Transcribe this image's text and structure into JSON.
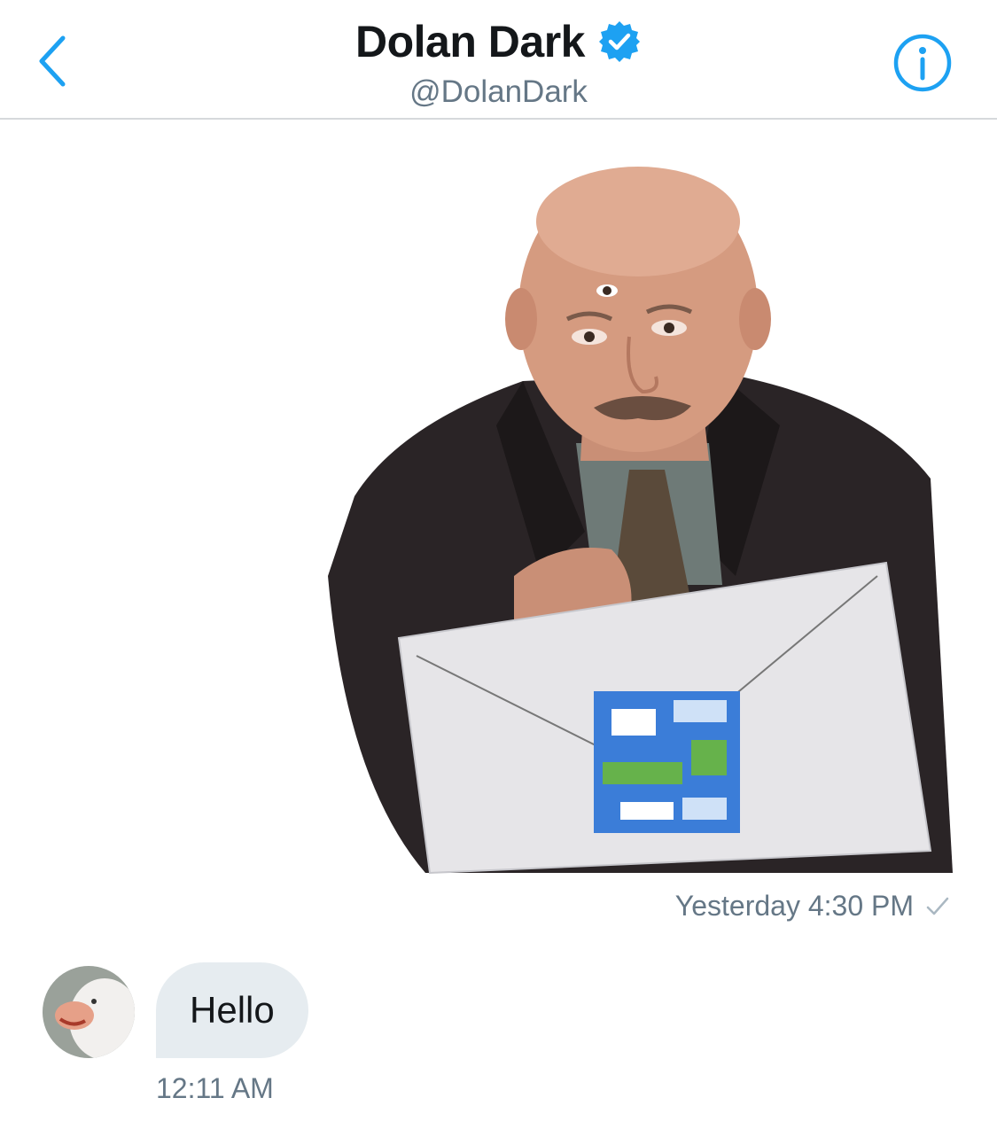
{
  "header": {
    "back_icon": "chevron-left-icon",
    "name": "Dolan Dark",
    "verified_icon": "verified-badge-icon",
    "handle": "@DolanDark",
    "info_icon": "info-icon",
    "accent_color": "#1da1f2"
  },
  "messages": {
    "sent_media": {
      "image_description_icon": "photo-sticker-image",
      "timestamp": "Yesterday 4:30 PM",
      "status_icon": "check-icon"
    },
    "received": {
      "avatar_icon": "avatar-image",
      "text": "Hello",
      "timestamp": "12:11 AM"
    }
  }
}
